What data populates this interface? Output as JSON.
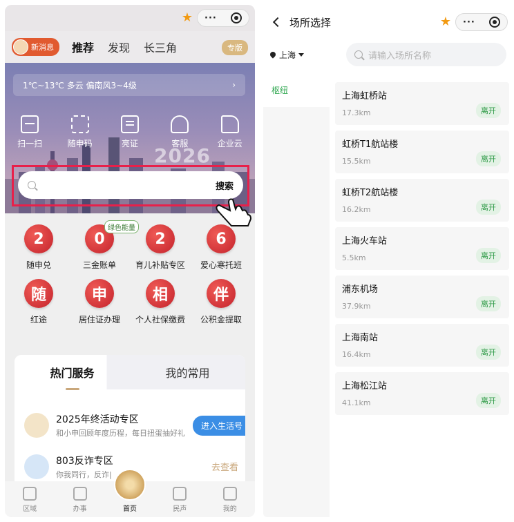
{
  "left": {
    "capsule": {
      "star_icon": "star-icon",
      "more": "···"
    },
    "nav": {
      "news_label": "新消息",
      "tabs": [
        "推荐",
        "发现",
        "长三角"
      ],
      "edition": "专版"
    },
    "weather": "1℃~13℃ 多云 偏南风3~4级",
    "weather_arrow": "›",
    "quick": [
      {
        "label": "扫一扫",
        "icon": "scan-icon"
      },
      {
        "label": "随申码",
        "icon": "qr-code-icon"
      },
      {
        "label": "亮证",
        "icon": "certificate-icon"
      },
      {
        "label": "客服",
        "icon": "customer-service-icon"
      },
      {
        "label": "企业云",
        "icon": "enterprise-cloud-icon"
      }
    ],
    "year": "2026",
    "search": {
      "button": "搜索"
    },
    "grid": [
      {
        "glyph": "2",
        "label": "随申兑"
      },
      {
        "glyph": "0",
        "label": "三金账单",
        "tag": "绿色能量"
      },
      {
        "glyph": "2",
        "label": "育儿补贴专区"
      },
      {
        "glyph": "6",
        "label": "爱心寒托班"
      },
      {
        "glyph": "随",
        "label": "红途"
      },
      {
        "glyph": "申",
        "label": "居住证办理"
      },
      {
        "glyph": "相",
        "label": "个人社保缴费"
      },
      {
        "glyph": "伴",
        "label": "公积金提取"
      }
    ],
    "card": {
      "tabs": [
        "热门服务",
        "我的常用"
      ],
      "items": [
        {
          "title": "2025年终活动专区",
          "subtitle": "和小申回顾年度历程，每日扭蛋抽好礼",
          "action": "进入生活号"
        },
        {
          "title": "803反诈专区",
          "subtitle": "你我同行，反诈|",
          "action": "去查看"
        }
      ]
    },
    "tabbar": [
      "区域",
      "办事",
      "首页",
      "民声",
      "我的"
    ]
  },
  "right": {
    "title": "场所选择",
    "city": "上海",
    "search_placeholder": "请输入场所名称",
    "categories": [
      "枢纽"
    ],
    "places": [
      {
        "name": "上海虹桥站",
        "distance": "17.3km",
        "action": "离开"
      },
      {
        "name": "虹桥T1航站楼",
        "distance": "15.5km",
        "action": "离开"
      },
      {
        "name": "虹桥T2航站楼",
        "distance": "16.2km",
        "action": "离开"
      },
      {
        "name": "上海火车站",
        "distance": "5.5km",
        "action": "离开"
      },
      {
        "name": "浦东机场",
        "distance": "37.9km",
        "action": "离开"
      },
      {
        "name": "上海南站",
        "distance": "16.4km",
        "action": "离开"
      },
      {
        "name": "上海松江站",
        "distance": "41.1km",
        "action": "离开"
      }
    ]
  },
  "colors": {
    "accent_red": "#e8204a",
    "gold": "#c9a77b",
    "green": "#2e9a46",
    "star": "#f29a12"
  }
}
